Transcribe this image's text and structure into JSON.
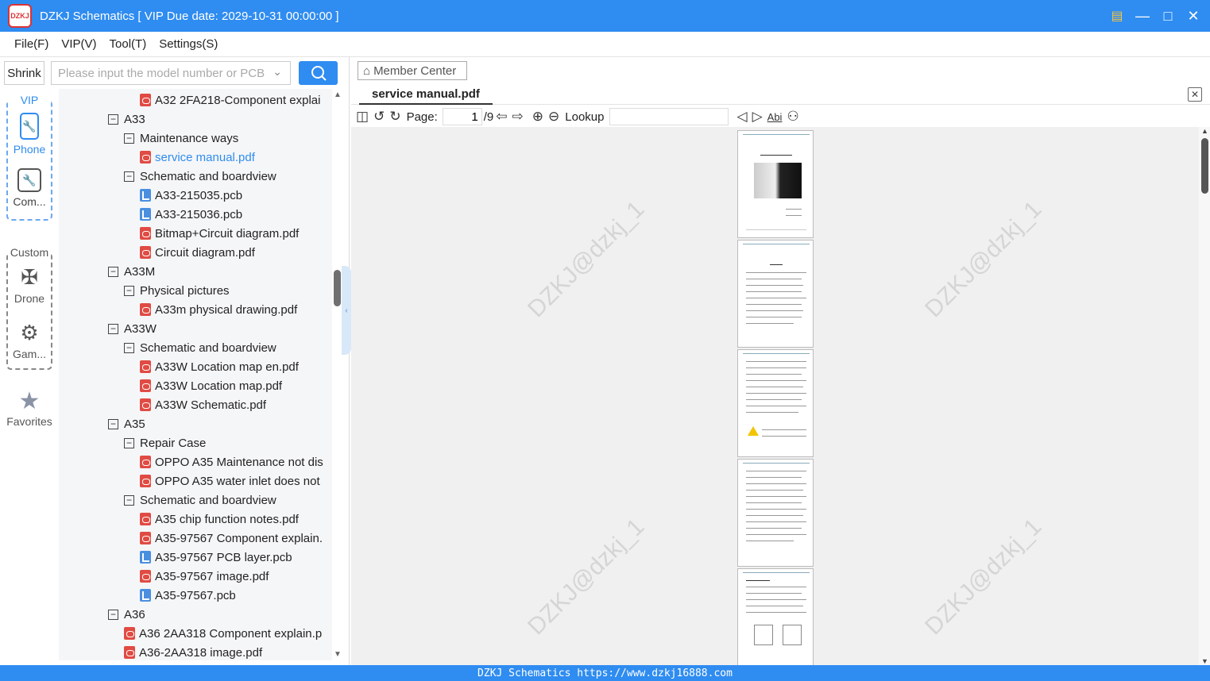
{
  "window": {
    "title": "DZKJ Schematics [ VIP Due date: 2029-10-31 00:00:00 ]",
    "logo_text": "DZKJ",
    "controls": [
      "minimize",
      "maximize",
      "close"
    ]
  },
  "menu": [
    "File(F)",
    "VIP(V)",
    "Tool(T)",
    "Settings(S)"
  ],
  "search": {
    "shrink_label": "Shrink",
    "placeholder": "Please input the model number or PCB"
  },
  "rail": {
    "vip_label": "VIP",
    "phone_label": "Phone",
    "computer_label": "Com...",
    "custom_label": "Custom",
    "drone_label": "Drone",
    "game_label": "Gam...",
    "favorites_label": "Favorites"
  },
  "tree": [
    {
      "level": 3,
      "type": "pdf",
      "text": "A32 2FA218-Component explai"
    },
    {
      "level": 1,
      "type": "folder",
      "text": "A33"
    },
    {
      "level": 2,
      "type": "folder",
      "text": "Maintenance ways"
    },
    {
      "level": 3,
      "type": "pdf",
      "text": "service manual.pdf",
      "selected": true
    },
    {
      "level": 2,
      "type": "folder",
      "text": "Schematic and boardview"
    },
    {
      "level": 3,
      "type": "pcb",
      "text": "A33-215035.pcb"
    },
    {
      "level": 3,
      "type": "pcb",
      "text": "A33-215036.pcb"
    },
    {
      "level": 3,
      "type": "pdf",
      "text": "Bitmap+Circuit diagram.pdf"
    },
    {
      "level": 3,
      "type": "pdf",
      "text": "Circuit diagram.pdf"
    },
    {
      "level": 1,
      "type": "folder",
      "text": "A33M"
    },
    {
      "level": 2,
      "type": "folder",
      "text": "Physical pictures"
    },
    {
      "level": 3,
      "type": "pdf",
      "text": "A33m physical drawing.pdf"
    },
    {
      "level": 1,
      "type": "folder",
      "text": "A33W"
    },
    {
      "level": 2,
      "type": "folder",
      "text": "Schematic and boardview"
    },
    {
      "level": 3,
      "type": "pdf",
      "text": "A33W Location map en.pdf"
    },
    {
      "level": 3,
      "type": "pdf",
      "text": "A33W Location map.pdf"
    },
    {
      "level": 3,
      "type": "pdf",
      "text": "A33W Schematic.pdf"
    },
    {
      "level": 1,
      "type": "folder",
      "text": "A35"
    },
    {
      "level": 2,
      "type": "folder",
      "text": "Repair Case"
    },
    {
      "level": 3,
      "type": "pdf",
      "text": "OPPO A35 Maintenance not dis"
    },
    {
      "level": 3,
      "type": "pdf",
      "text": "OPPO A35 water inlet does not"
    },
    {
      "level": 2,
      "type": "folder",
      "text": "Schematic and boardview"
    },
    {
      "level": 3,
      "type": "pdf",
      "text": "A35 chip function notes.pdf"
    },
    {
      "level": 3,
      "type": "pdf",
      "text": "A35-97567 Component explain."
    },
    {
      "level": 3,
      "type": "pcb",
      "text": "A35-97567 PCB layer.pcb"
    },
    {
      "level": 3,
      "type": "pdf",
      "text": "A35-97567 image.pdf"
    },
    {
      "level": 3,
      "type": "pcb",
      "text": "A35-97567.pcb"
    },
    {
      "level": 1,
      "type": "folder",
      "text": "A36"
    },
    {
      "level": 2,
      "type": "pdf",
      "text": "A36 2AA318 Component explain.p"
    },
    {
      "level": 2,
      "type": "pdf",
      "text": "A36-2AA318 image.pdf"
    }
  ],
  "viewer": {
    "member_center": "Member Center",
    "tab_title": "service manual.pdf",
    "page_label": "Page:",
    "page_current": "1",
    "page_total": "/9",
    "lookup_label": "Lookup",
    "watermark": "DZKJ@dzkj_1"
  },
  "status": {
    "text": "DZKJ Schematics https://www.dzkj16888.com"
  }
}
